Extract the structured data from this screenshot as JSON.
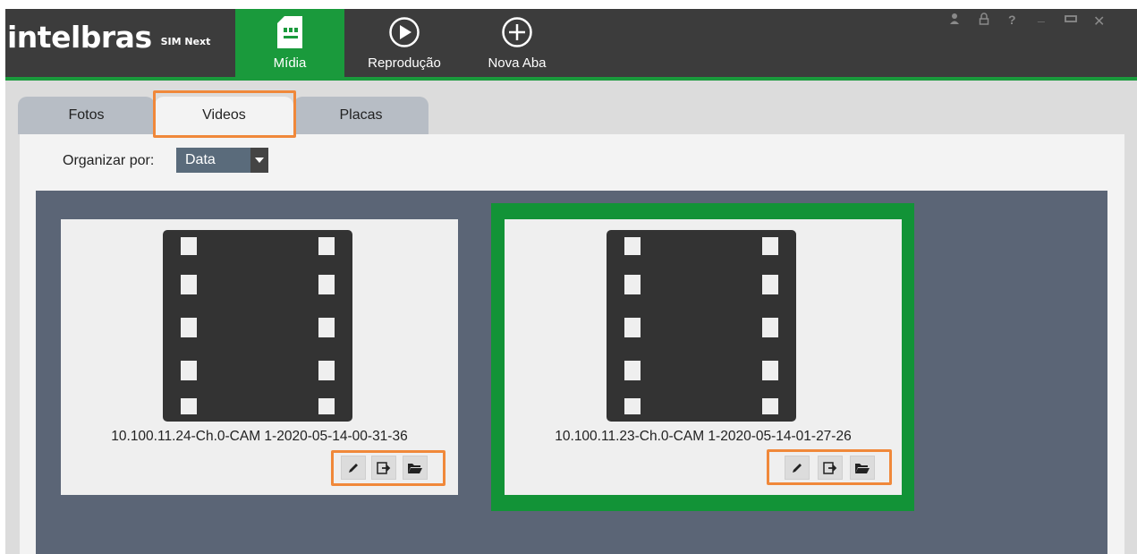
{
  "app": {
    "brand": "intelbras",
    "product": "SIM Next"
  },
  "nav": {
    "items": [
      {
        "label": "Mídia",
        "icon": "media-sdcard-icon",
        "active": true
      },
      {
        "label": "Reprodução",
        "icon": "play-circle-icon",
        "active": false
      },
      {
        "label": "Nova Aba",
        "icon": "plus-circle-icon",
        "active": false
      }
    ]
  },
  "window_controls": [
    {
      "icon": "user-icon",
      "glyph": "👤"
    },
    {
      "icon": "lock-icon",
      "glyph": "🔒"
    },
    {
      "icon": "help-icon",
      "glyph": "?"
    },
    {
      "icon": "minimize-icon",
      "glyph": "_"
    },
    {
      "icon": "maximize-icon",
      "glyph": "▭"
    },
    {
      "icon": "close-icon",
      "glyph": "✕"
    }
  ],
  "tabs": [
    {
      "label": "Fotos",
      "active": false
    },
    {
      "label": "Videos",
      "active": true
    },
    {
      "label": "Placas",
      "active": false
    }
  ],
  "sort": {
    "label": "Organizar por:",
    "value": "Data"
  },
  "videos": [
    {
      "filename": "10.100.11.24-Ch.0-CAM 1-2020-05-14-00-31-36",
      "selected": false
    },
    {
      "filename": "10.100.11.23-Ch.0-CAM 1-2020-05-14-01-27-26",
      "selected": true
    }
  ],
  "colors": {
    "accent_green": "#1a9a3c",
    "titlebar": "#3c3c3c",
    "highlight_orange": "#f0883a",
    "grid_bg": "#5b6576"
  }
}
